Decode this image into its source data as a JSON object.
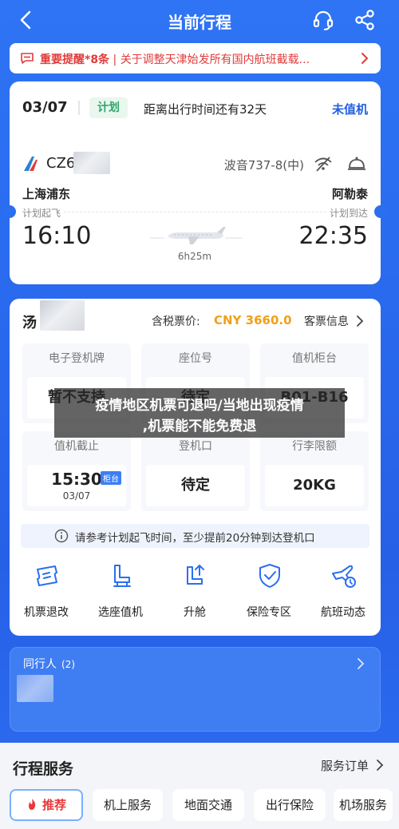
{
  "header": {
    "title": "当前行程"
  },
  "notice": {
    "prefix": "重要提醒*8条",
    "separator": "|",
    "text": "关于调整天津始发所有国内航班截载..."
  },
  "trip": {
    "date": "03/07",
    "plan_tag": "计划",
    "countdown": "距离出行时间还有32天",
    "checkin_status": "未值机",
    "flight_no_prefix": "CZ6",
    "aircraft": "波音737-8(中)",
    "departure": {
      "city": "上海浦东",
      "label": "计划起飞",
      "time": "16:10"
    },
    "arrival": {
      "city": "阿勒泰",
      "label": "计划到达",
      "time": "22:35"
    },
    "duration": "6h25m"
  },
  "ticket": {
    "passenger_prefix": "汤",
    "price_label": "含税票价:",
    "price": "CNY 3660.0",
    "passenger_info": "客票信息",
    "cells": [
      {
        "label": "电子登机牌",
        "value": "暂不支持"
      },
      {
        "label": "座位号",
        "value": "待定"
      },
      {
        "label": "值机柜台",
        "value": "B01-B16"
      },
      {
        "label": "值机截止",
        "time": "15:30",
        "tag": "柜台",
        "date": "03/07"
      },
      {
        "label": "登机口",
        "value": "待定"
      },
      {
        "label": "行李限额",
        "value": "20KG"
      }
    ],
    "tip": "请参考计划起飞时间，至少提前20分钟到达登机口",
    "actions": [
      {
        "label": "机票退改",
        "icon": "ticket-change-icon"
      },
      {
        "label": "选座值机",
        "icon": "seat-icon"
      },
      {
        "label": "升舱",
        "icon": "upgrade-icon"
      },
      {
        "label": "保险专区",
        "icon": "shield-icon"
      },
      {
        "label": "航班动态",
        "icon": "flight-status-icon"
      }
    ]
  },
  "companions": {
    "title": "同行人",
    "count": "(2)"
  },
  "services": {
    "title": "行程服务",
    "orders": "服务订单",
    "tabs": [
      "推荐",
      "机上服务",
      "地面交通",
      "出行保险",
      "机场服务"
    ]
  },
  "overlay": {
    "line1": "疫情地区机票可退吗/当地出现疫情",
    "line2": ",机票能不能免费退"
  },
  "colors": {
    "primary": "#2b6ff1",
    "alert": "#e23b3b",
    "price": "#f0a019",
    "status": "#1f5fe0",
    "plan_tag": "#2fa36b"
  }
}
